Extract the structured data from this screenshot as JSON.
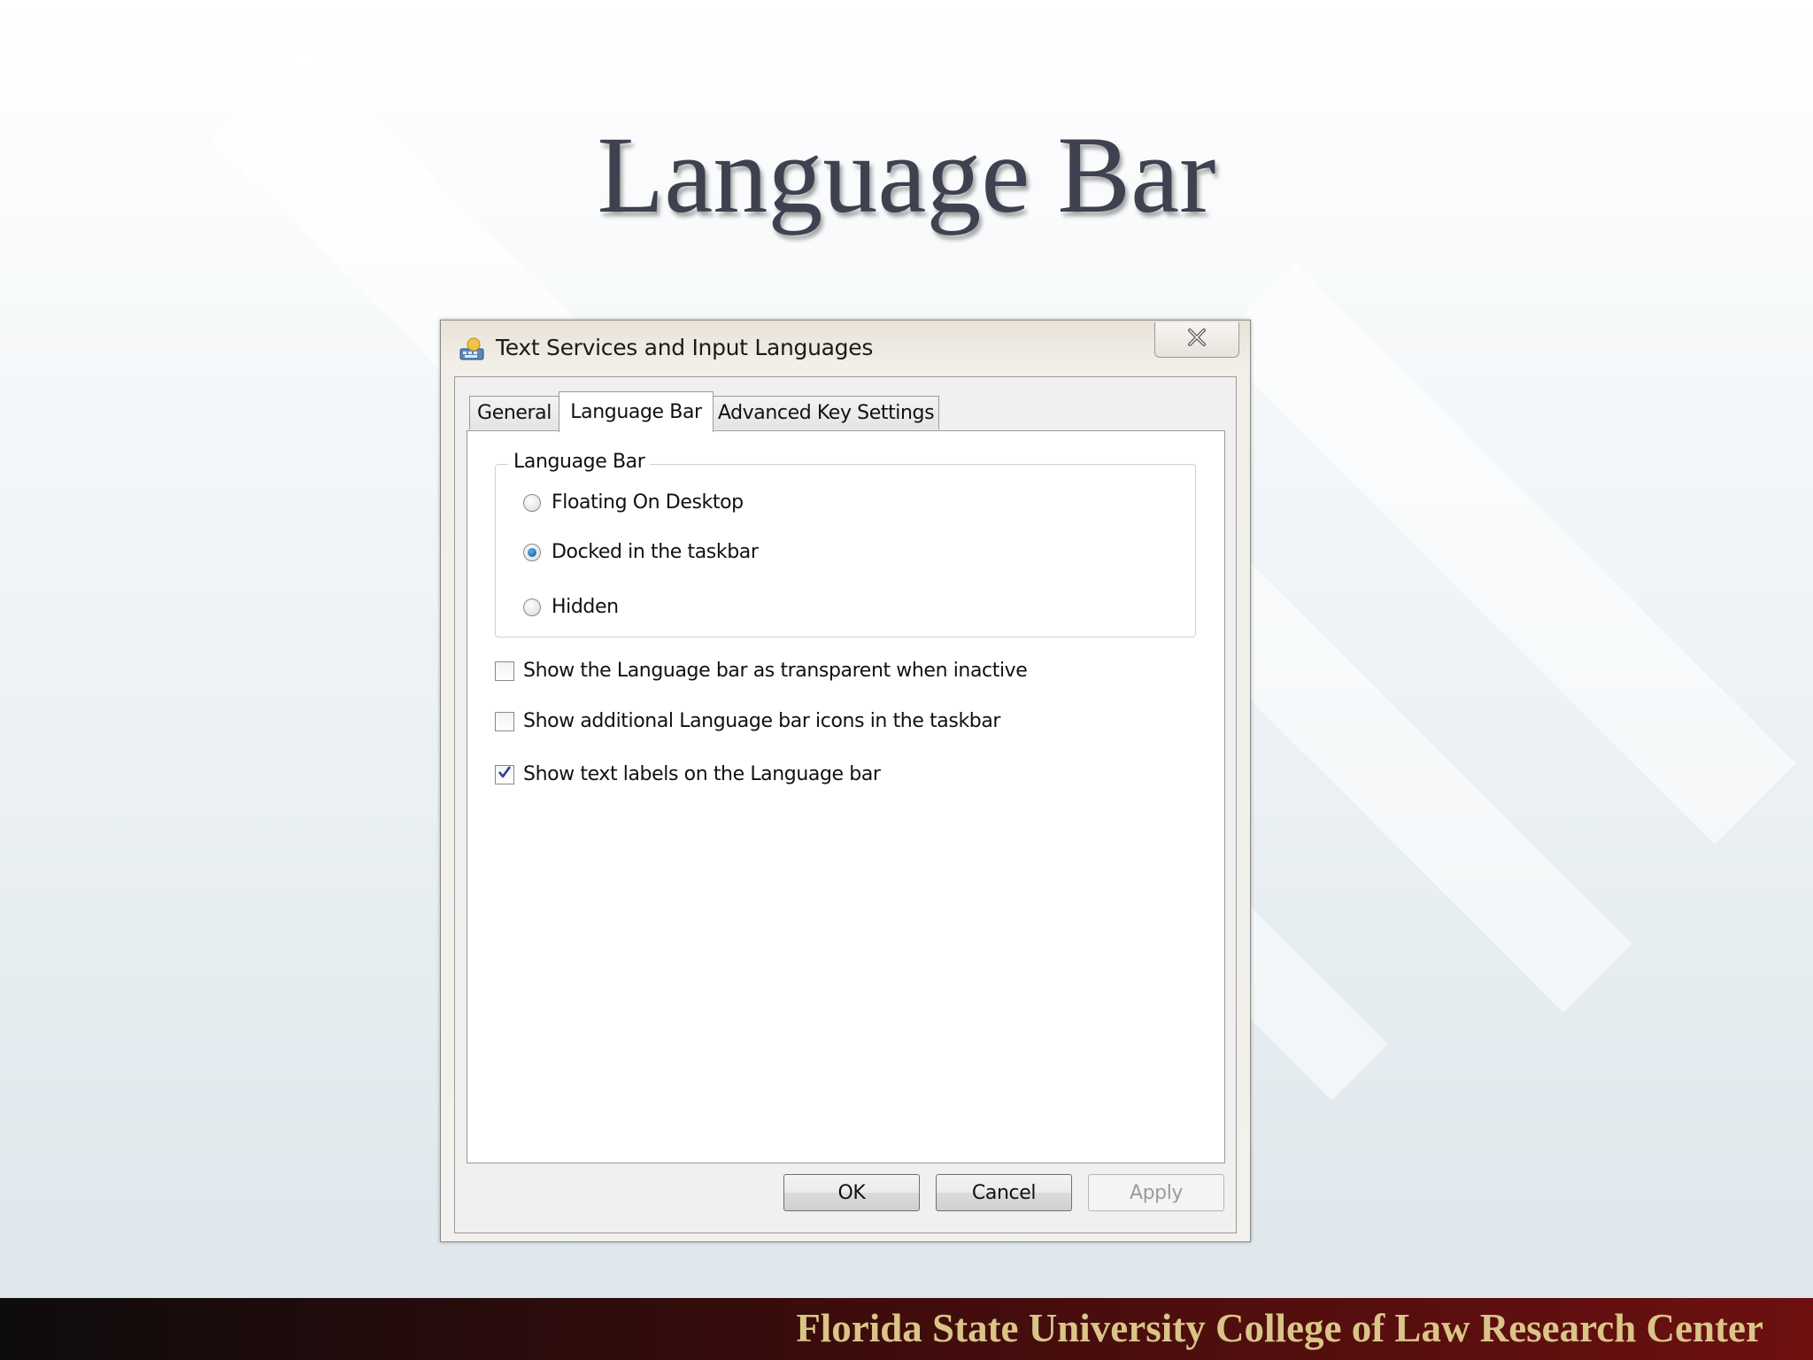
{
  "slide": {
    "title": "Language Bar",
    "footer": "Florida State University College of Law Research Center"
  },
  "dialog": {
    "title": "Text Services and Input Languages",
    "icons": {
      "app": "keyboard-globe-icon",
      "close": "close-icon"
    },
    "tabs": [
      {
        "label": "General",
        "selected": false
      },
      {
        "label": "Language Bar",
        "selected": true
      },
      {
        "label": "Advanced Key Settings",
        "selected": false
      }
    ],
    "group": {
      "label": "Language Bar",
      "options": [
        {
          "label": "Floating On Desktop",
          "selected": false
        },
        {
          "label": "Docked in the taskbar",
          "selected": true
        },
        {
          "label": "Hidden",
          "selected": false
        }
      ]
    },
    "checkboxes": [
      {
        "label": "Show the Language bar as transparent when inactive",
        "checked": false
      },
      {
        "label": "Show additional Language bar icons in the taskbar",
        "checked": false
      },
      {
        "label": "Show text labels on the Language bar",
        "checked": true
      }
    ],
    "buttons": {
      "ok": "OK",
      "cancel": "Cancel",
      "apply": "Apply",
      "apply_enabled": false
    }
  }
}
